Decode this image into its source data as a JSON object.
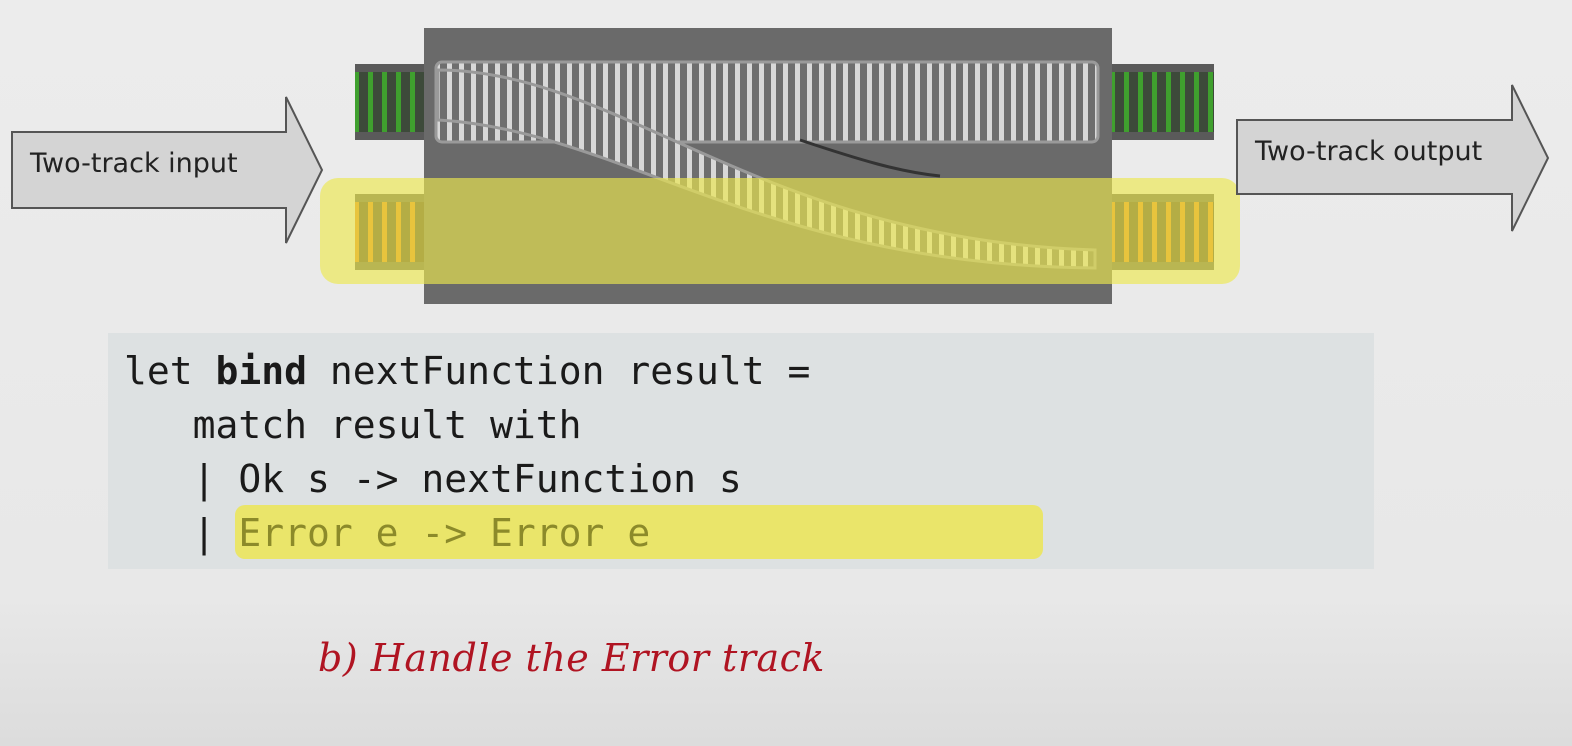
{
  "diagram": {
    "input_label": "Two-track input",
    "output_label": "Two-track output"
  },
  "code": {
    "line1_prefix": "let ",
    "line1_keyword": "bind",
    "line1_rest": " nextFunction result =",
    "line2": "   match result with",
    "line3": "   | Ok s -> nextFunction s",
    "line4_bar": "   | ",
    "line4_highlighted": "Error e -> Error e"
  },
  "caption": "b) Handle the Error track",
  "colors": {
    "success_track": "#3a8a2a",
    "failure_track": "#e08020",
    "highlight": "#eae56a",
    "caption": "#b01422"
  }
}
